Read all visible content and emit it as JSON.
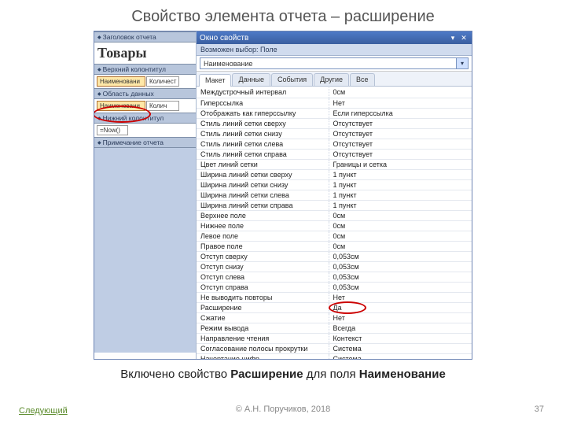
{
  "slide": {
    "title": "Свойство элемента отчета – расширение",
    "caption_prefix": "Включено свойство ",
    "caption_bold1": "Расширение",
    "caption_mid": " для поля ",
    "caption_bold2": "Наименование",
    "next": "Следующий",
    "copyright": "© А.Н. Поручиков, 2018",
    "page": "37"
  },
  "designer": {
    "sections": {
      "report_header": "Заголовок отчета",
      "page_header": "Верхний колонтитул",
      "detail": "Область данных",
      "page_footer": "Нижний колонтитул",
      "report_footer": "Примечание отчета"
    },
    "title_field": "Товары",
    "header_fields": [
      "Наименовани",
      "Количест"
    ],
    "detail_fields": [
      "Наименовани",
      "Колич"
    ],
    "footer_expr": "=Now()"
  },
  "props": {
    "window_title": "Окно свойств",
    "selection_type": "Возможен выбор:  Поле",
    "selection_name": "Наименование",
    "tabs": [
      "Макет",
      "Данные",
      "События",
      "Другие",
      "Все"
    ],
    "rows": [
      {
        "n": "Междустрочный интервал",
        "v": "0см"
      },
      {
        "n": "Гиперссылка",
        "v": "Нет"
      },
      {
        "n": "Отображать как гиперссылку",
        "v": "Если гиперссылка"
      },
      {
        "n": "Стиль линий сетки сверху",
        "v": "Отсутствует"
      },
      {
        "n": "Стиль линий сетки снизу",
        "v": "Отсутствует"
      },
      {
        "n": "Стиль линий сетки слева",
        "v": "Отсутствует"
      },
      {
        "n": "Стиль линий сетки справа",
        "v": "Отсутствует"
      },
      {
        "n": "Цвет линий сетки",
        "v": "Границы и сетка"
      },
      {
        "n": "Ширина линий сетки сверху",
        "v": "1 пункт"
      },
      {
        "n": "Ширина линий сетки снизу",
        "v": "1 пункт"
      },
      {
        "n": "Ширина линий сетки слева",
        "v": "1 пункт"
      },
      {
        "n": "Ширина линий сетки справа",
        "v": "1 пункт"
      },
      {
        "n": "Верхнее поле",
        "v": "0см"
      },
      {
        "n": "Нижнее поле",
        "v": "0см"
      },
      {
        "n": "Левое поле",
        "v": "0см"
      },
      {
        "n": "Правое поле",
        "v": "0см"
      },
      {
        "n": "Отступ сверху",
        "v": "0,053см"
      },
      {
        "n": "Отступ снизу",
        "v": "0,053см"
      },
      {
        "n": "Отступ слева",
        "v": "0,053см"
      },
      {
        "n": "Отступ справа",
        "v": "0,053см"
      },
      {
        "n": "Не выводить повторы",
        "v": "Нет"
      },
      {
        "n": "Расширение",
        "v": "Да"
      },
      {
        "n": "Сжатие",
        "v": "Нет"
      },
      {
        "n": "Режим вывода",
        "v": "Всегда"
      },
      {
        "n": "Направление чтения",
        "v": "Контекст"
      },
      {
        "n": "Согласование полосы прокрутки",
        "v": "Система"
      },
      {
        "n": "Начертание цифр",
        "v": "Система"
      }
    ]
  }
}
